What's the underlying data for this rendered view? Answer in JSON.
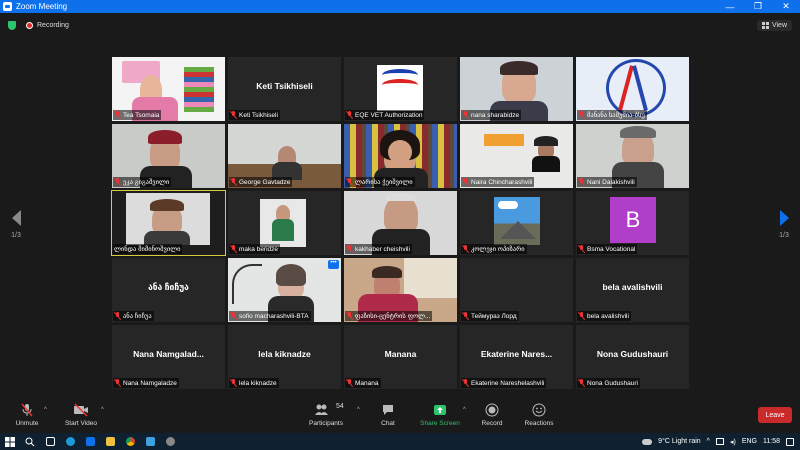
{
  "window": {
    "title": "Zoom Meeting",
    "minimize": "—",
    "restore": "❐",
    "close": "✕"
  },
  "meeting": {
    "recording": "Recording",
    "view": "View"
  },
  "nav": {
    "left_page": "1/3",
    "right_page": "1/3"
  },
  "tiles": [
    {
      "big": "",
      "label": "Tea Tsomaia",
      "muted": true
    },
    {
      "big": "Keti Tsikhiseli",
      "label": "Keti Tsikhiseli",
      "muted": true
    },
    {
      "big": "",
      "label": "EQE VET Authorization",
      "muted": true
    },
    {
      "big": "",
      "label": "nana sharabidze",
      "muted": true
    },
    {
      "big": "",
      "label": "მანანა სამუშია-ბსუ",
      "muted": true
    },
    {
      "big": "",
      "label": "ეკა გიგაშვილი",
      "muted": true
    },
    {
      "big": "",
      "label": "George Gavtadze",
      "muted": true
    },
    {
      "big": "",
      "label": "ლარისა ჭეიშვილი",
      "muted": true
    },
    {
      "big": "",
      "label": "Naira Chincharashvili",
      "muted": true
    },
    {
      "big": "",
      "label": "Nani Dalakishvili",
      "muted": true
    },
    {
      "big": "",
      "label": "ლინდა მიმინოშვილი",
      "muted": false
    },
    {
      "big": "",
      "label": "maka beridze",
      "muted": true
    },
    {
      "big": "",
      "label": "kakhaber cheishvili",
      "muted": true
    },
    {
      "big": "",
      "label": "კოლეჯი ოპიზარი",
      "muted": true
    },
    {
      "big": "",
      "label": "Bsma Vocational",
      "muted": true
    },
    {
      "big": "ანა ჩიჩუა",
      "label": "ანა ჩიჩუა",
      "muted": true
    },
    {
      "big": "",
      "label": "sofio macharashvili-BTA",
      "muted": true
    },
    {
      "big": "",
      "label": "ფაზისი-ცენტრის ფოლ...",
      "muted": true
    },
    {
      "big": "",
      "label": "Теймураз Лорд",
      "muted": true
    },
    {
      "big": "bela avalishvili",
      "label": "bela avalishvili",
      "muted": true
    },
    {
      "big": "Nana Namgalad...",
      "label": "Nana Namgaladze",
      "muted": true
    },
    {
      "big": "lela kiknadze",
      "label": "lela kiknadze",
      "muted": true
    },
    {
      "big": "Manana",
      "label": "Manana",
      "muted": true
    },
    {
      "big": "Ekaterine Nares...",
      "label": "Ekaterine Nareshelashvili",
      "muted": true
    },
    {
      "big": "Nona Gudushauri",
      "label": "Nona Gudushauri",
      "muted": true
    }
  ],
  "bsma_letter": "B",
  "more_dots": "•••",
  "toolbar": {
    "unmute": "Unmute",
    "start_video": "Start Video",
    "participants": "Participants",
    "participants_count": "54",
    "chat": "Chat",
    "share_screen": "Share Screen",
    "record": "Record",
    "reactions": "Reactions",
    "leave": "Leave"
  },
  "taskbar": {
    "weather": "9°C  Light rain",
    "lang": "ENG",
    "time": "11:58"
  },
  "colors": {
    "accent": "#0e71eb",
    "share": "#2ec36d",
    "leave": "#c92a2a",
    "active_border": "#d6cc3e"
  }
}
